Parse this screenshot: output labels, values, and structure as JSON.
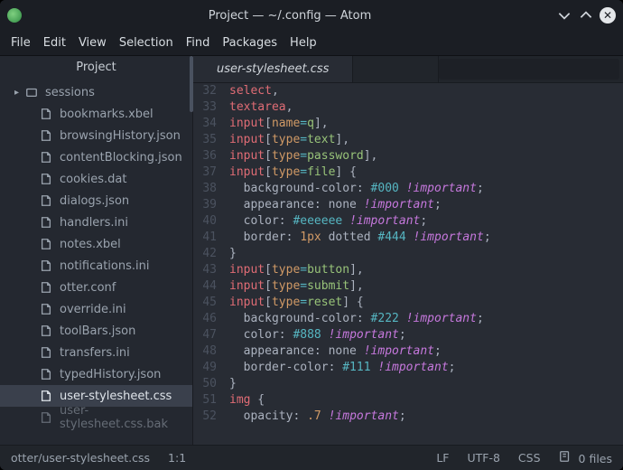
{
  "window": {
    "title": "Project — ~/.config — Atom"
  },
  "menubar": [
    "File",
    "Edit",
    "View",
    "Selection",
    "Find",
    "Packages",
    "Help"
  ],
  "sidebar": {
    "title": "Project",
    "items": [
      {
        "type": "folder",
        "label": "sessions"
      },
      {
        "type": "file",
        "label": "bookmarks.xbel"
      },
      {
        "type": "file",
        "label": "browsingHistory.json"
      },
      {
        "type": "file",
        "label": "contentBlocking.json"
      },
      {
        "type": "file",
        "label": "cookies.dat"
      },
      {
        "type": "file",
        "label": "dialogs.json"
      },
      {
        "type": "file",
        "label": "handlers.ini"
      },
      {
        "type": "file",
        "label": "notes.xbel"
      },
      {
        "type": "file",
        "label": "notifications.ini"
      },
      {
        "type": "file",
        "label": "otter.conf"
      },
      {
        "type": "file",
        "label": "override.ini"
      },
      {
        "type": "file",
        "label": "toolBars.json"
      },
      {
        "type": "file",
        "label": "transfers.ini"
      },
      {
        "type": "file",
        "label": "typedHistory.json"
      },
      {
        "type": "file",
        "label": "user-stylesheet.css",
        "selected": true
      },
      {
        "type": "file",
        "label": "user-stylesheet.css.bak",
        "dim": true
      }
    ]
  },
  "tabs": {
    "active": "user-stylesheet.css"
  },
  "gutter_start": 32,
  "gutter_end": 52,
  "code_lines": [
    [
      [
        "tag",
        "select"
      ],
      [
        "punc",
        ","
      ]
    ],
    [
      [
        "tag",
        "textarea"
      ],
      [
        "punc",
        ","
      ]
    ],
    [
      [
        "tag",
        "input"
      ],
      [
        "punc",
        "["
      ],
      [
        "attr",
        "name"
      ],
      [
        "op",
        "="
      ],
      [
        "str",
        "q"
      ],
      [
        "punc",
        "],"
      ]
    ],
    [
      [
        "tag",
        "input"
      ],
      [
        "punc",
        "["
      ],
      [
        "attr",
        "type"
      ],
      [
        "op",
        "="
      ],
      [
        "str",
        "text"
      ],
      [
        "punc",
        "],"
      ]
    ],
    [
      [
        "tag",
        "input"
      ],
      [
        "punc",
        "["
      ],
      [
        "attr",
        "type"
      ],
      [
        "op",
        "="
      ],
      [
        "str",
        "password"
      ],
      [
        "punc",
        "],"
      ]
    ],
    [
      [
        "tag",
        "input"
      ],
      [
        "punc",
        "["
      ],
      [
        "attr",
        "type"
      ],
      [
        "op",
        "="
      ],
      [
        "str",
        "file"
      ],
      [
        "punc",
        "] "
      ],
      [
        "punc",
        "{"
      ]
    ],
    [
      [
        "prop",
        "  background-color"
      ],
      [
        "punc",
        ": "
      ],
      [
        "hex",
        "#000"
      ],
      [
        "punc",
        " "
      ],
      [
        "kw",
        "!important"
      ],
      [
        "punc",
        ";"
      ]
    ],
    [
      [
        "prop",
        "  appearance"
      ],
      [
        "punc",
        ": "
      ],
      [
        "prop",
        "none "
      ],
      [
        "kw",
        "!important"
      ],
      [
        "punc",
        ";"
      ]
    ],
    [
      [
        "prop",
        "  color"
      ],
      [
        "punc",
        ": "
      ],
      [
        "hex",
        "#eeeeee"
      ],
      [
        "punc",
        " "
      ],
      [
        "kw",
        "!important"
      ],
      [
        "punc",
        ";"
      ]
    ],
    [
      [
        "prop",
        "  border"
      ],
      [
        "punc",
        ": "
      ],
      [
        "num",
        "1px"
      ],
      [
        "prop",
        " dotted "
      ],
      [
        "hex",
        "#444"
      ],
      [
        "punc",
        " "
      ],
      [
        "kw",
        "!important"
      ],
      [
        "punc",
        ";"
      ]
    ],
    [
      [
        "punc",
        "}"
      ]
    ],
    [
      [
        "tag",
        "input"
      ],
      [
        "punc",
        "["
      ],
      [
        "attr",
        "type"
      ],
      [
        "op",
        "="
      ],
      [
        "str",
        "button"
      ],
      [
        "punc",
        "],"
      ]
    ],
    [
      [
        "tag",
        "input"
      ],
      [
        "punc",
        "["
      ],
      [
        "attr",
        "type"
      ],
      [
        "op",
        "="
      ],
      [
        "str",
        "submit"
      ],
      [
        "punc",
        "],"
      ]
    ],
    [
      [
        "tag",
        "input"
      ],
      [
        "punc",
        "["
      ],
      [
        "attr",
        "type"
      ],
      [
        "op",
        "="
      ],
      [
        "str",
        "reset"
      ],
      [
        "punc",
        "] "
      ],
      [
        "punc",
        "{"
      ]
    ],
    [
      [
        "prop",
        "  background-color"
      ],
      [
        "punc",
        ": "
      ],
      [
        "hex",
        "#222"
      ],
      [
        "punc",
        " "
      ],
      [
        "kw",
        "!important"
      ],
      [
        "punc",
        ";"
      ]
    ],
    [
      [
        "prop",
        "  color"
      ],
      [
        "punc",
        ": "
      ],
      [
        "hex",
        "#888"
      ],
      [
        "punc",
        " "
      ],
      [
        "kw",
        "!important"
      ],
      [
        "punc",
        ";"
      ]
    ],
    [
      [
        "prop",
        "  appearance"
      ],
      [
        "punc",
        ": "
      ],
      [
        "prop",
        "none "
      ],
      [
        "kw",
        "!important"
      ],
      [
        "punc",
        ";"
      ]
    ],
    [
      [
        "prop",
        "  border-color"
      ],
      [
        "punc",
        ": "
      ],
      [
        "hex",
        "#111"
      ],
      [
        "punc",
        " "
      ],
      [
        "kw",
        "!important"
      ],
      [
        "punc",
        ";"
      ]
    ],
    [
      [
        "punc",
        "}"
      ]
    ],
    [
      [
        "tag",
        "img"
      ],
      [
        "punc",
        " {"
      ]
    ],
    [
      [
        "prop",
        "  opacity"
      ],
      [
        "punc",
        ": "
      ],
      [
        "num",
        ".7"
      ],
      [
        "punc",
        " "
      ],
      [
        "kw",
        "!important"
      ],
      [
        "punc",
        ";"
      ]
    ]
  ],
  "statusbar": {
    "path": "otter/user-stylesheet.css",
    "cursor": "1:1",
    "eol": "LF",
    "encoding": "UTF-8",
    "lang": "CSS",
    "git": "0 files"
  }
}
